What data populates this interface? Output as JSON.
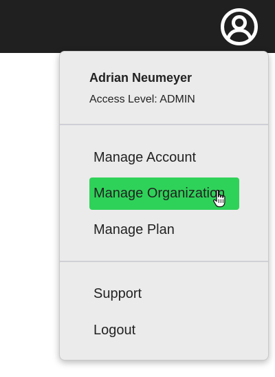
{
  "header": {
    "account_icon": "user-circle-icon"
  },
  "user_menu": {
    "user_name": "Adrian Neumeyer",
    "access_level": "Access Level: ADMIN",
    "items": [
      {
        "label": "Manage Account",
        "active": false
      },
      {
        "label": "Manage Organization",
        "active": true
      },
      {
        "label": "Manage Plan",
        "active": false
      }
    ],
    "footer_items": [
      {
        "label": "Support"
      },
      {
        "label": "Logout"
      }
    ]
  },
  "colors": {
    "header_bg": "#202020",
    "menu_bg": "#ebebeb",
    "highlight": "#2fd259"
  },
  "cursor_icon": "hand-pointer-icon"
}
